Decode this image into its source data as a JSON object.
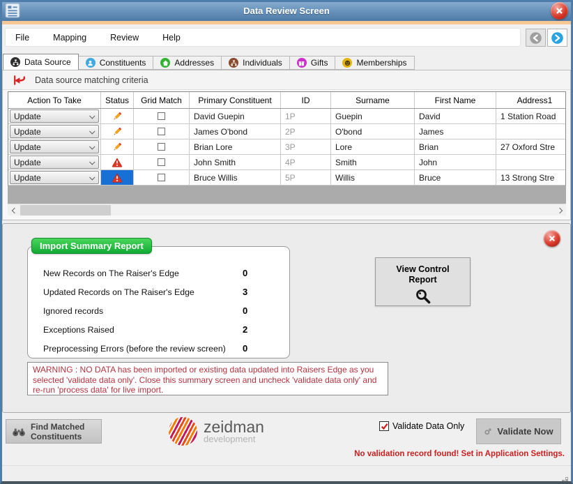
{
  "window": {
    "title": "Data Review Screen"
  },
  "menu": {
    "items": [
      "File",
      "Mapping",
      "Review",
      "Help"
    ]
  },
  "tabs": [
    {
      "label": "Data Source",
      "color": "#2e2e2e"
    },
    {
      "label": "Constituents",
      "color": "#3fa9e0"
    },
    {
      "label": "Addresses",
      "color": "#33b233"
    },
    {
      "label": "Individuals",
      "color": "#8a4a2c"
    },
    {
      "label": "Gifts",
      "color": "#cb2ecb"
    },
    {
      "label": "Memberships",
      "color": "#e5b412"
    }
  ],
  "grid": {
    "header_label": "Data source matching criteria",
    "columns": [
      "Action To Take",
      "Status",
      "Grid Match",
      "Primary Constituent",
      "ID",
      "Surname",
      "First Name",
      "Address1"
    ],
    "rows": [
      {
        "action": "Update",
        "status": "pencil",
        "selected": false,
        "grid_match": false,
        "primary": "David Guepin",
        "id": "1P",
        "surname": "Guepin",
        "first_name": "David",
        "address1": "1 Station Road"
      },
      {
        "action": "Update",
        "status": "pencil",
        "selected": false,
        "grid_match": false,
        "primary": "James O'bond",
        "id": "2P",
        "surname": "O'bond",
        "first_name": "James",
        "address1": ""
      },
      {
        "action": "Update",
        "status": "pencil",
        "selected": false,
        "grid_match": false,
        "primary": "Brian Lore",
        "id": "3P",
        "surname": "Lore",
        "first_name": "Brian",
        "address1": "27 Oxford Stre"
      },
      {
        "action": "Update",
        "status": "warning",
        "selected": false,
        "grid_match": false,
        "primary": "John  Smith",
        "id": "4P",
        "surname": "Smith",
        "first_name": "John",
        "address1": ""
      },
      {
        "action": "Update",
        "status": "warning",
        "selected": true,
        "grid_match": false,
        "primary": "Bruce  Willis",
        "id": "5P",
        "surname": "Willis",
        "first_name": "Bruce",
        "address1": "13 Strong Stre"
      }
    ]
  },
  "summary": {
    "title": "Import Summary Report",
    "stats": [
      {
        "label": "New Records on The Raiser's Edge",
        "value": "0"
      },
      {
        "label": "Updated Records on The Raiser's Edge",
        "value": "3"
      },
      {
        "label": "Ignored records",
        "value": "0"
      },
      {
        "label": "Exceptions Raised",
        "value": "2"
      },
      {
        "label": "Preprocessing Errors (before the review screen)",
        "value": "0"
      }
    ],
    "view_control_label": "View Control Report",
    "warning": "WARNING : NO DATA has been imported or existing data updated into Raisers Edge as you selected 'validate data only'. Close this summary screen and uncheck 'validate data only' and re-run 'process data' for live import."
  },
  "footer": {
    "find_matched_label": "Find Matched Constituents",
    "logo_name": "zeidman",
    "logo_sub": "development",
    "validate_only_label": "Validate Data Only",
    "validate_only_checked": true,
    "validate_now_label": "Validate Now",
    "note": "No validation record found!  Set in Application Settings."
  },
  "colors": {
    "titlebar": "#5d87b2",
    "accent_strip": "#f6c795",
    "badge_green": "#12aa35",
    "warning_text": "#b5323f",
    "selected_cell": "#1770d6"
  }
}
